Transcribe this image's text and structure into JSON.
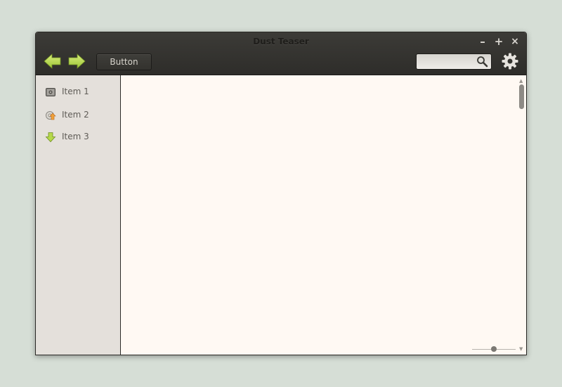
{
  "window": {
    "title": "Dust Teaser",
    "controls": {
      "minimize": "–",
      "maximize": "+",
      "close": "×"
    }
  },
  "toolbar": {
    "back_icon": "arrow-left-icon",
    "forward_icon": "arrow-right-icon",
    "button_label": "Button",
    "search": {
      "value": "",
      "placeholder": "",
      "icon": "magnifier-icon"
    },
    "settings_icon": "gear-icon"
  },
  "sidebar": {
    "items": [
      {
        "label": "Item 1",
        "icon": "drive-icon"
      },
      {
        "label": "Item 2",
        "icon": "gear-update-icon"
      },
      {
        "label": "Item 3",
        "icon": "arrow-down-icon"
      }
    ]
  },
  "content": {
    "scroll_position": 0,
    "zoom_level": 0.5
  },
  "colors": {
    "accent_green": "#b6d94a",
    "background": "#d6ded6",
    "toolbar": "#32312d",
    "sidebar": "#e4e0db",
    "content": "#fff9f3"
  }
}
